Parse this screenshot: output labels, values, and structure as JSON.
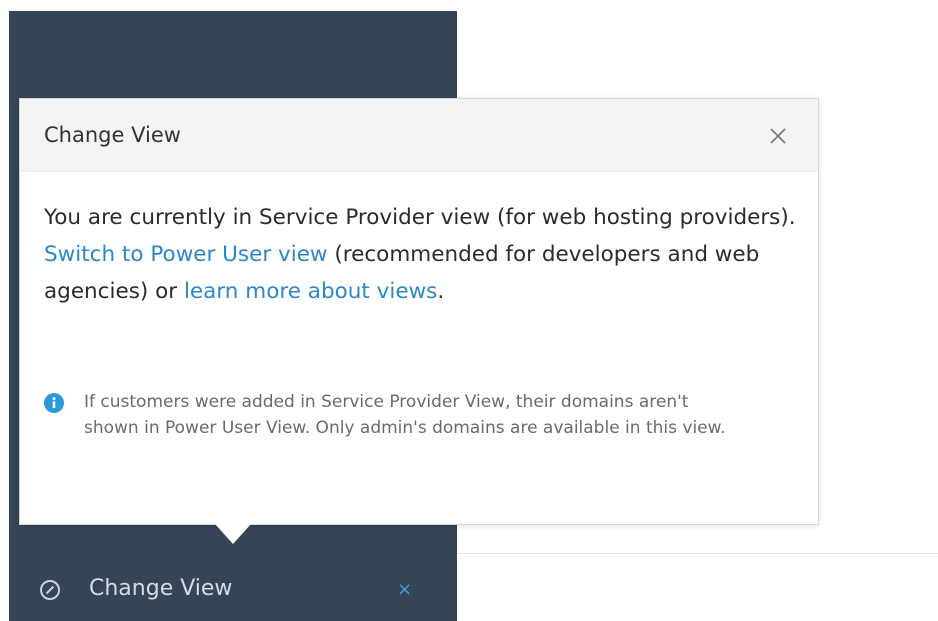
{
  "sidebar": {
    "item_label": "Change View",
    "item_icon": "circle-slash-icon",
    "close_glyph": "×",
    "bg_color": "#364457",
    "accent_color": "#3aa0dc"
  },
  "popover": {
    "title": "Change View",
    "close_icon": "close-icon",
    "body": {
      "line1": "You are currently in Service Provider view (for web hosting providers).",
      "switch_link": "Switch to Power User view",
      "middle_text": " (recommended for developers and web agencies) or ",
      "learn_link": "learn more about views",
      "end_text": "."
    },
    "note": {
      "icon": "info-icon",
      "text": "If customers were added in Service Provider View, their domains aren't shown in Power User View. Only admin's domains are available in this view."
    },
    "link_color": "#2b87c8"
  }
}
